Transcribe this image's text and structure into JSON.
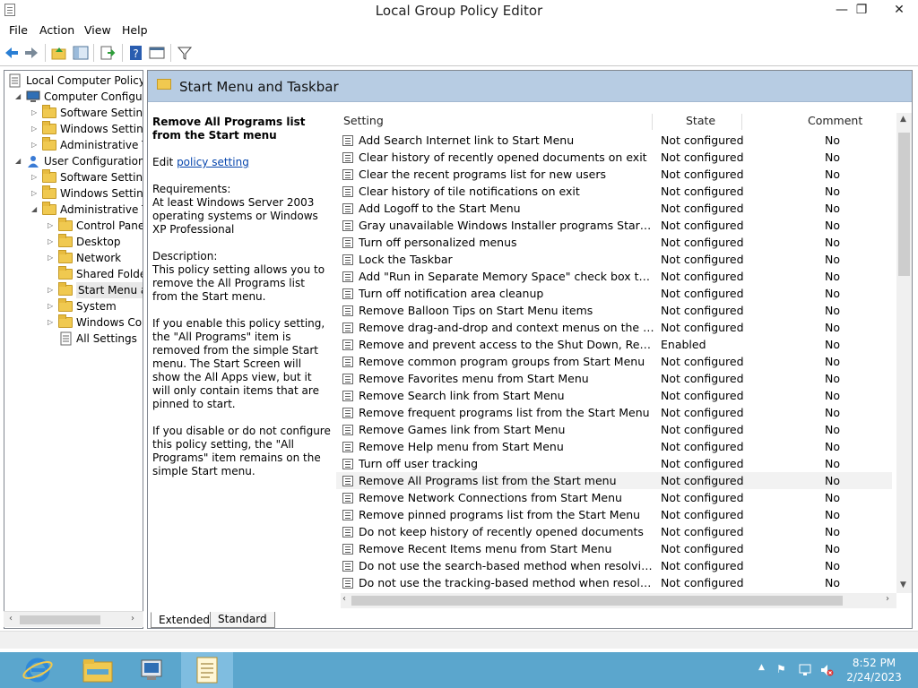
{
  "window": {
    "title": "Local Group Policy Editor",
    "minimize": "—",
    "restore": "❐",
    "close": "✕"
  },
  "menu": [
    "File",
    "Action",
    "View",
    "Help"
  ],
  "tree": [
    {
      "label": "Local Computer Policy",
      "depth": 0,
      "arrow": ""
    },
    {
      "label": "Computer Configura",
      "depth": 1,
      "arrow": "◢"
    },
    {
      "label": "Software Settings",
      "depth": 2,
      "arrow": "▷"
    },
    {
      "label": "Windows Setting",
      "depth": 2,
      "arrow": "▷"
    },
    {
      "label": "Administrative Te",
      "depth": 2,
      "arrow": "▷"
    },
    {
      "label": "User Configuration",
      "depth": 1,
      "arrow": "◢"
    },
    {
      "label": "Software Settings",
      "depth": 2,
      "arrow": "▷"
    },
    {
      "label": "Windows Setting",
      "depth": 2,
      "arrow": "▷"
    },
    {
      "label": "Administrative Te",
      "depth": 2,
      "arrow": "◢"
    },
    {
      "label": "Control Panel",
      "depth": 3,
      "arrow": "▷"
    },
    {
      "label": "Desktop",
      "depth": 3,
      "arrow": "▷"
    },
    {
      "label": "Network",
      "depth": 3,
      "arrow": "▷"
    },
    {
      "label": "Shared Folder",
      "depth": 3,
      "arrow": ""
    },
    {
      "label": "Start Menu ar",
      "depth": 3,
      "arrow": "▷"
    },
    {
      "label": "System",
      "depth": 3,
      "arrow": "▷"
    },
    {
      "label": "Windows Cor",
      "depth": 3,
      "arrow": "▷"
    },
    {
      "label": "All Settings",
      "depth": 3,
      "arrow": ""
    }
  ],
  "header": {
    "title": "Start Menu and Taskbar"
  },
  "description": {
    "title": "Remove All Programs list from the Start menu",
    "edit_prefix": "Edit ",
    "edit_link": "policy setting",
    "requirements_label": "Requirements:",
    "requirements": "At least Windows Server 2003 operating systems or Windows XP Professional",
    "description_label": "Description:",
    "p1": "This policy setting allows you to remove the All Programs list from the Start menu.",
    "p2": "If you enable this policy setting, the \"All Programs\" item is removed from the simple Start menu.  The Start Screen will show the All Apps view, but it will only contain items that are pinned to start.",
    "p3": "If you disable or do not configure this policy setting, the \"All Programs\" item remains on the simple Start menu."
  },
  "columns": {
    "setting": "Setting",
    "state": "State",
    "comment": "Comment"
  },
  "rows": [
    {
      "name": "Add Search Internet link to Start Menu",
      "state": "Not configured",
      "comment": "No"
    },
    {
      "name": "Clear history of recently opened documents on exit",
      "state": "Not configured",
      "comment": "No"
    },
    {
      "name": "Clear the recent programs list for new users",
      "state": "Not configured",
      "comment": "No"
    },
    {
      "name": "Clear history of tile notifications on exit",
      "state": "Not configured",
      "comment": "No"
    },
    {
      "name": "Add Logoff to the Start Menu",
      "state": "Not configured",
      "comment": "No"
    },
    {
      "name": "Gray unavailable Windows Installer programs Start Menu sh...",
      "state": "Not configured",
      "comment": "No"
    },
    {
      "name": "Turn off personalized menus",
      "state": "Not configured",
      "comment": "No"
    },
    {
      "name": "Lock the Taskbar",
      "state": "Not configured",
      "comment": "No"
    },
    {
      "name": "Add \"Run in Separate Memory Space\" check box to Run dial...",
      "state": "Not configured",
      "comment": "No"
    },
    {
      "name": "Turn off notification area cleanup",
      "state": "Not configured",
      "comment": "No"
    },
    {
      "name": "Remove Balloon Tips on Start Menu items",
      "state": "Not configured",
      "comment": "No"
    },
    {
      "name": "Remove drag-and-drop and context menus on the Start Me...",
      "state": "Not configured",
      "comment": "No"
    },
    {
      "name": "Remove and prevent access to the Shut Down, Restart, Sleep...",
      "state": "Enabled",
      "comment": "No"
    },
    {
      "name": "Remove common program groups from Start Menu",
      "state": "Not configured",
      "comment": "No"
    },
    {
      "name": "Remove Favorites menu from Start Menu",
      "state": "Not configured",
      "comment": "No"
    },
    {
      "name": "Remove Search link from Start Menu",
      "state": "Not configured",
      "comment": "No"
    },
    {
      "name": "Remove frequent programs list from the Start Menu",
      "state": "Not configured",
      "comment": "No"
    },
    {
      "name": "Remove Games link from Start Menu",
      "state": "Not configured",
      "comment": "No"
    },
    {
      "name": "Remove Help menu from Start Menu",
      "state": "Not configured",
      "comment": "No"
    },
    {
      "name": "Turn off user tracking",
      "state": "Not configured",
      "comment": "No"
    },
    {
      "name": "Remove All Programs list from the Start menu",
      "state": "Not configured",
      "comment": "No"
    },
    {
      "name": "Remove Network Connections from Start Menu",
      "state": "Not configured",
      "comment": "No"
    },
    {
      "name": "Remove pinned programs list from the Start Menu",
      "state": "Not configured",
      "comment": "No"
    },
    {
      "name": "Do not keep history of recently opened documents",
      "state": "Not configured",
      "comment": "No"
    },
    {
      "name": "Remove Recent Items menu from Start Menu",
      "state": "Not configured",
      "comment": "No"
    },
    {
      "name": "Do not use the search-based method when resolving shell s...",
      "state": "Not configured",
      "comment": "No"
    },
    {
      "name": "Do not use the tracking-based method when resolving shell ...",
      "state": "Not configured",
      "comment": "No"
    }
  ],
  "selected_row": 20,
  "tabs": [
    "Extended",
    "Standard"
  ],
  "taskbar": {
    "time": "8:52 PM",
    "date": "2/24/2023"
  }
}
